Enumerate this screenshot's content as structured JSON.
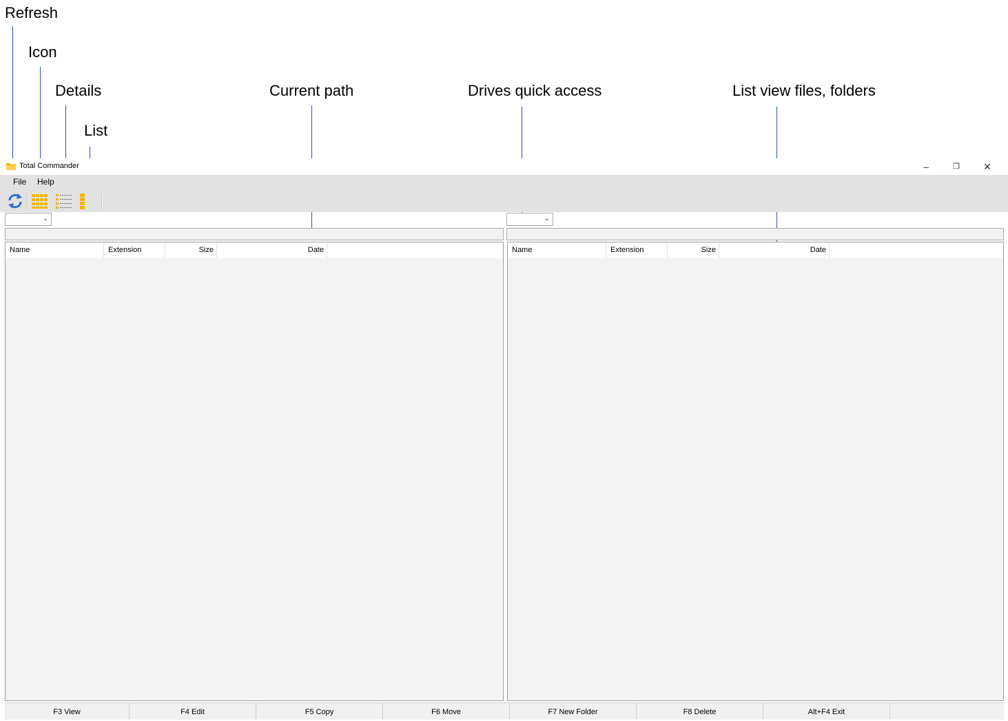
{
  "annotations": {
    "refresh": "Refresh",
    "icon": "Icon",
    "details": "Details",
    "list": "List",
    "current_path": "Current path",
    "drives": "Drives quick access",
    "list_view": "List view files, folders"
  },
  "window": {
    "title": "Total Commander",
    "minimize": "–",
    "maximize": "❐",
    "close": "✕"
  },
  "menu": {
    "file": "File",
    "help": "Help"
  },
  "toolbar": {
    "refresh_icon": "refresh-icon",
    "icon_view_icon": "icon-view-icon",
    "details_view_icon": "details-view-icon",
    "list_view_icon": "list-view-icon"
  },
  "left_panel": {
    "drive_value": "",
    "path": "",
    "columns": {
      "name": "Name",
      "extension": "Extension",
      "size": "Size",
      "date": "Date"
    }
  },
  "right_panel": {
    "drive_value": "",
    "path": "",
    "columns": {
      "name": "Name",
      "extension": "Extension",
      "size": "Size",
      "date": "Date"
    }
  },
  "function_keys": {
    "f3": "F3 View",
    "f4": "F4 Edit",
    "f5": "F5 Copy",
    "f6": "F6 Move",
    "f7": "F7 New Folder",
    "f8": "F8 Delete",
    "altf4": "Alt+F4 Exit"
  },
  "colors": {
    "menu_bg": "#e2e2e2",
    "panel_bg": "#f3f3f3",
    "annotation_line": "#2f4bc6",
    "toolbar_accent": "#f5b400"
  }
}
